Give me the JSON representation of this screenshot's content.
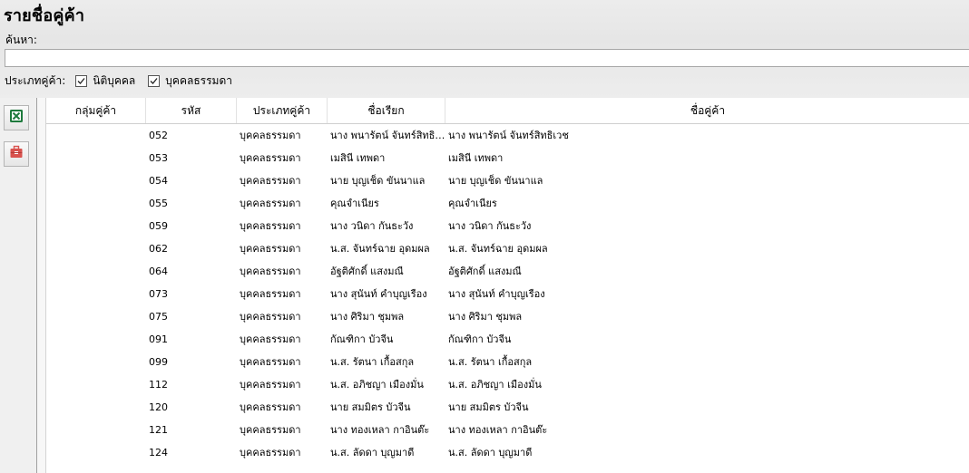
{
  "title": "รายชื่อคู่ค้า",
  "search": {
    "label": "ค้นหา:",
    "value": "",
    "placeholder": ""
  },
  "filter": {
    "label": "ประเภทคู่ค้า:",
    "options": [
      {
        "label": "นิติบุคคล",
        "checked": true
      },
      {
        "label": "บุคคลธรรมดา",
        "checked": true
      }
    ]
  },
  "toolbar": {
    "buttons": [
      {
        "icon": "excel-export-icon",
        "color": "#1e7a3c"
      },
      {
        "icon": "toolbox-icon",
        "color": "#d9534f"
      }
    ]
  },
  "table": {
    "columns": [
      "กลุ่มคู่ค้า",
      "รหัส",
      "ประเภทคู่ค้า",
      "ชื่อเรียก",
      "ชื่อคู่ค้า"
    ],
    "rows": [
      [
        "",
        "052",
        "บุคคลธรรมดา",
        "นาง พนารัตน์ จันทร์สิทธิเวช",
        "นาง พนารัตน์ จันทร์สิทธิเวช"
      ],
      [
        "",
        "053",
        "บุคคลธรรมดา",
        "เมสินี เทพดา",
        "เมสินี เทพดา"
      ],
      [
        "",
        "054",
        "บุคคลธรรมดา",
        "นาย บุญเช็ด ขันนาแล",
        "นาย บุญเช็ด ขันนาแล"
      ],
      [
        "",
        "055",
        "บุคคลธรรมดา",
        "คุณจำเนียร",
        "คุณจำเนียร"
      ],
      [
        "",
        "059",
        "บุคคลธรรมดา",
        "นาง วนิดา กันธะวัง",
        "นาง วนิดา กันธะวัง"
      ],
      [
        "",
        "062",
        "บุคคลธรรมดา",
        "น.ส. จันทร์ฉาย อุดมผล",
        "น.ส. จันทร์ฉาย อุดมผล"
      ],
      [
        "",
        "064",
        "บุคคลธรรมดา",
        "อัฐติศักดิ์ แสงมณี",
        "อัฐติศักดิ์ แสงมณี"
      ],
      [
        "",
        "073",
        "บุคคลธรรมดา",
        "นาง สุนันท์ คำบุญเรือง",
        "นาง สุนันท์ คำบุญเรือง"
      ],
      [
        "",
        "075",
        "บุคคลธรรมดา",
        "นาง ศิริมา ชุมพล",
        "นาง ศิริมา ชุมพล"
      ],
      [
        "",
        "091",
        "บุคคลธรรมดา",
        "กัณฑิกา บัวจีน",
        "กัณฑิกา บัวจีน"
      ],
      [
        "",
        "099",
        "บุคคลธรรมดา",
        "น.ส. รัตนา เกื้อสกุล",
        "น.ส. รัตนา เกื้อสกุล"
      ],
      [
        "",
        "112",
        "บุคคลธรรมดา",
        "น.ส. อภิชญา เมืองมั่น",
        "น.ส. อภิชญา เมืองมั่น"
      ],
      [
        "",
        "120",
        "บุคคลธรรมดา",
        "นาย สมมิตร บัวจีน",
        "นาย สมมิตร บัวจีน"
      ],
      [
        "",
        "121",
        "บุคคลธรรมดา",
        "นาง ทองเหลา กาอินต๊ะ",
        "นาง ทองเหลา กาอินต๊ะ"
      ],
      [
        "",
        "124",
        "บุคคลธรรมดา",
        "น.ส. ลัดดา บุญมาดี",
        "น.ส. ลัดดา บุญมาดี"
      ]
    ]
  }
}
